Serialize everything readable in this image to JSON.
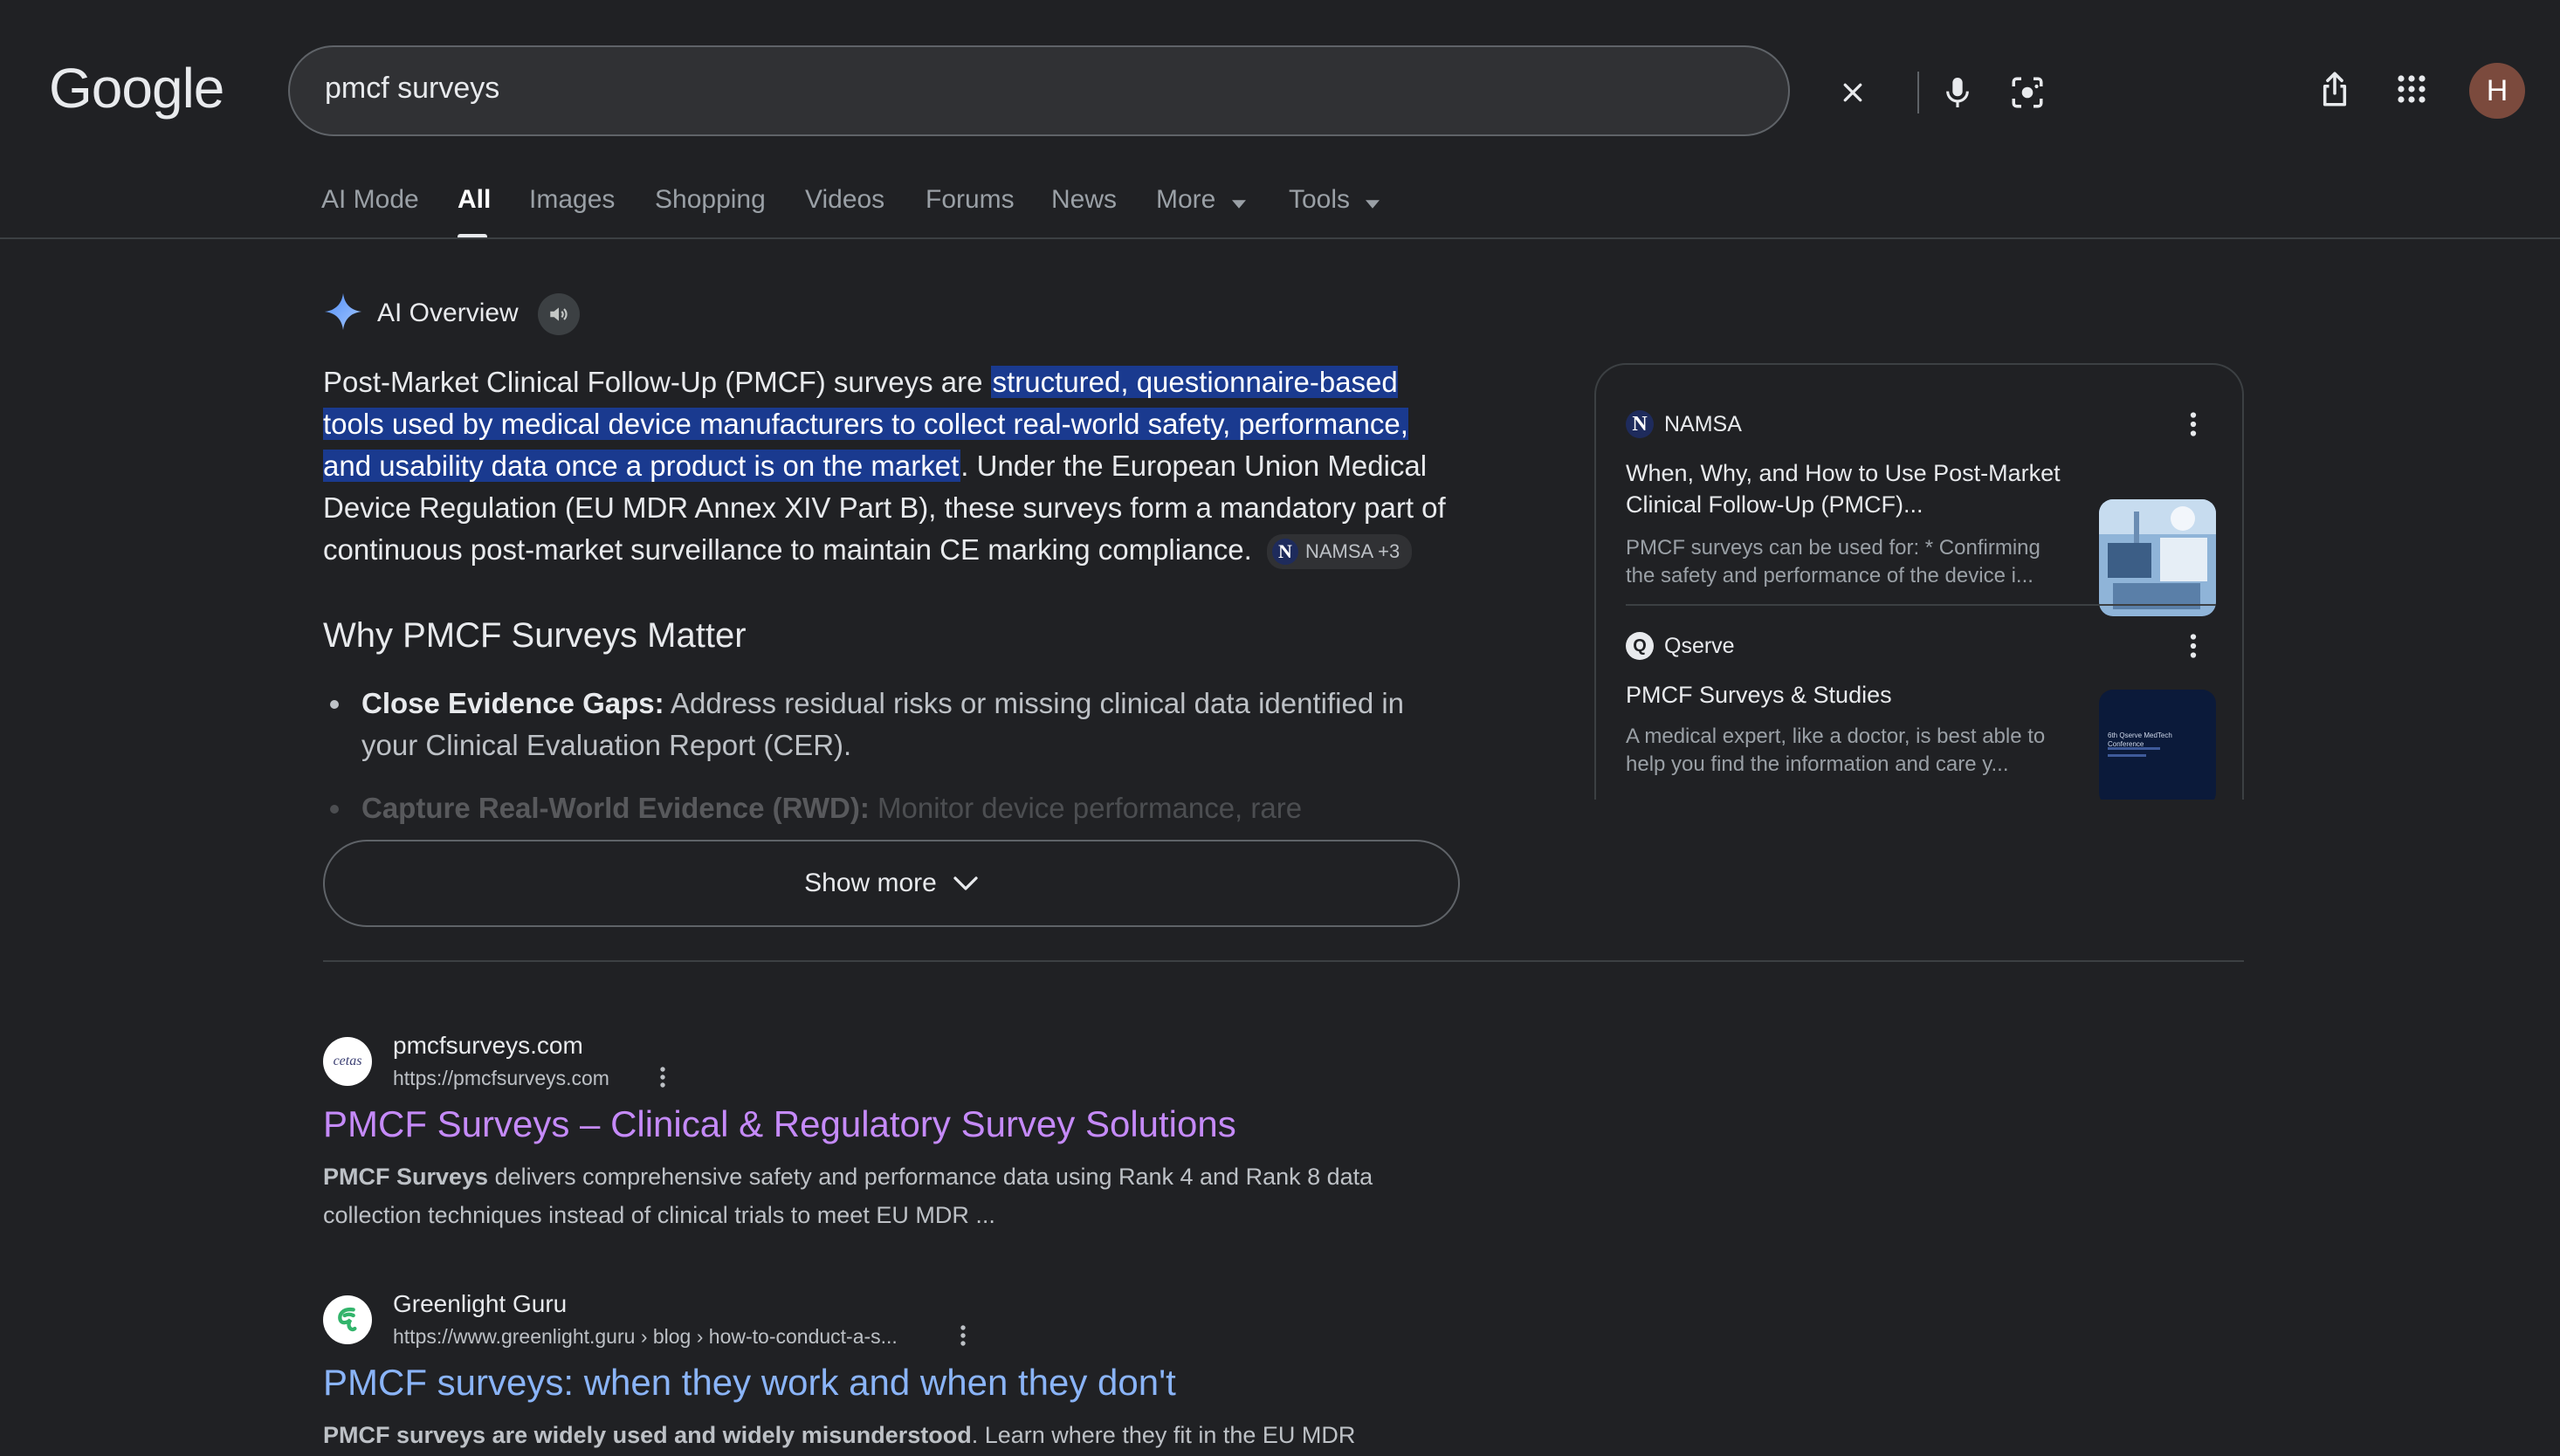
{
  "header": {
    "logo": "Google",
    "search_query": "pmcf surveys",
    "avatar_letter": "H"
  },
  "tabs": [
    {
      "label": "AI Mode"
    },
    {
      "label": "All"
    },
    {
      "label": "Images"
    },
    {
      "label": "Shopping"
    },
    {
      "label": "Videos"
    },
    {
      "label": "Forums"
    },
    {
      "label": "News"
    },
    {
      "label": "More"
    },
    {
      "label": "Tools"
    }
  ],
  "ai_overview": {
    "title": "AI Overview",
    "intro_plain_1": "Post-Market Clinical Follow-Up (PMCF) surveys are ",
    "intro_highlight": "structured, questionnaire-based tools used by medical device manufacturers to collect real-world safety, performance, and usability data once a product is on the market",
    "intro_plain_2": ". Under the European Union Medical Device Regulation (EU MDR Annex XIV Part B), these surveys form a mandatory part of continuous post-market surveillance to maintain CE marking compliance.",
    "chip_label": "NAMSA +3",
    "heading": "Why PMCF Surveys Matter",
    "bullets": [
      {
        "bold": "Close Evidence Gaps:",
        "text": " Address residual risks or missing clinical data identified in your Clinical Evaluation Report (CER)."
      },
      {
        "bold": "Capture Real-World Evidence (RWD):",
        "text": " Monitor device performance, rare"
      }
    ],
    "show_more": "Show more"
  },
  "sources": [
    {
      "site": "NAMSA",
      "logo_letter": "N",
      "title": "When, Why, and How to Use Post-Market Clinical Follow-Up (PMCF)...",
      "snippet": "PMCF surveys can be used for: * Confirming the safety and performance of the device i..."
    },
    {
      "site": "Qserve",
      "title": "PMCF Surveys & Studies",
      "snippet": "A medical expert, like a doctor, is best able to help you find the information and care y...",
      "thumb_text": "6th Qserve MedTech Conference"
    }
  ],
  "results": [
    {
      "site": "pmcfsurveys.com",
      "url": "https://pmcfsurveys.com",
      "favicon_text": "cetas",
      "title": "PMCF Surveys – Clinical & Regulatory Survey Solutions",
      "snippet_bold": "PMCF Surveys",
      "snippet": " delivers comprehensive safety and performance data using Rank 4 and Rank 8 data collection techniques instead of clinical trials to meet EU MDR ..."
    },
    {
      "site": "Greenlight Guru",
      "url": "https://www.greenlight.guru › blog › how-to-conduct-a-s...",
      "title": "PMCF surveys: when they work and when they don't",
      "snippet_bold": "PMCF surveys are widely used and widely misunderstood",
      "snippet": ". Learn where they fit in the EU MDR"
    }
  ],
  "colors": {
    "background": "#202124",
    "highlight": "#1a3a8f",
    "visited_link": "#c58af9",
    "link": "#8ab4f8"
  }
}
